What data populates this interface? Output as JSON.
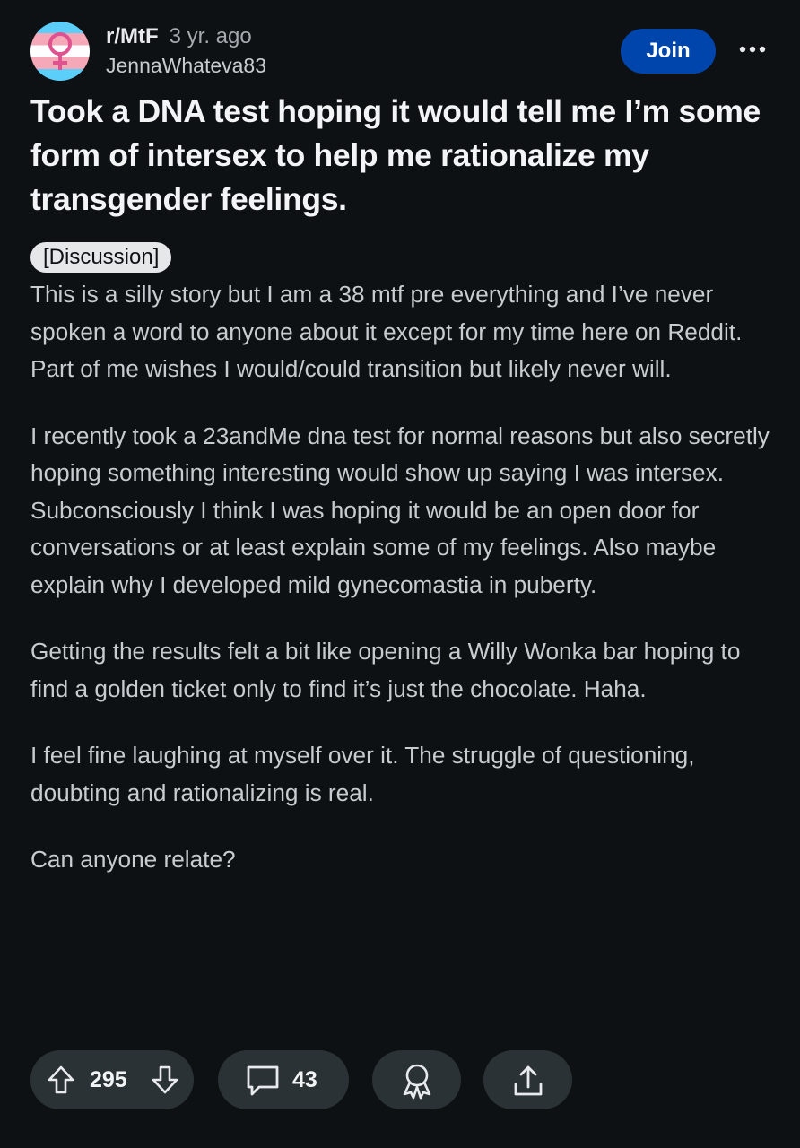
{
  "post": {
    "subreddit": "r/MtF",
    "age": "3 yr. ago",
    "username": "JennaWhateva83",
    "join_label": "Join",
    "title": "Took a DNA test hoping it would tell me I’m some form of intersex to help me rationalize my transgender feelings.",
    "flair": "[Discussion]",
    "paragraphs": [
      "This is a silly story but I am a 38 mtf pre everything and I’ve never spoken a word to anyone about it except for my time here on Reddit. Part of me wishes I would/could transition but likely never will.",
      "I recently took a 23andMe dna test for normal reasons but also secretly hoping something interesting would show up saying I was intersex. Subconsciously I think I was hoping it would be an open door for conversations or at least explain some of my feelings. Also maybe explain why I developed mild gynecomastia in puberty.",
      "Getting the results felt a bit like opening a Willy Wonka bar hoping to find a golden ticket only to find it’s just the chocolate. Haha.",
      "I feel fine laughing at myself over it. The struggle of questioning, doubting and rationalizing is real.",
      "Can anyone relate?"
    ]
  },
  "actions": {
    "upvotes": "295",
    "comments": "43"
  },
  "icons": {
    "avatar": "trans-flag-female-symbol-icon",
    "more": "more-horizontal-icon",
    "upvote": "arrow-up-icon",
    "downvote": "arrow-down-icon",
    "comment": "speech-bubble-icon",
    "award": "award-ribbon-icon",
    "share": "share-upload-icon"
  },
  "colors": {
    "background": "#0e1113",
    "join_button": "#0045ac",
    "pill": "#2a3236",
    "flag_blue": "#5bcefa",
    "flag_pink": "#f5a9b8"
  }
}
